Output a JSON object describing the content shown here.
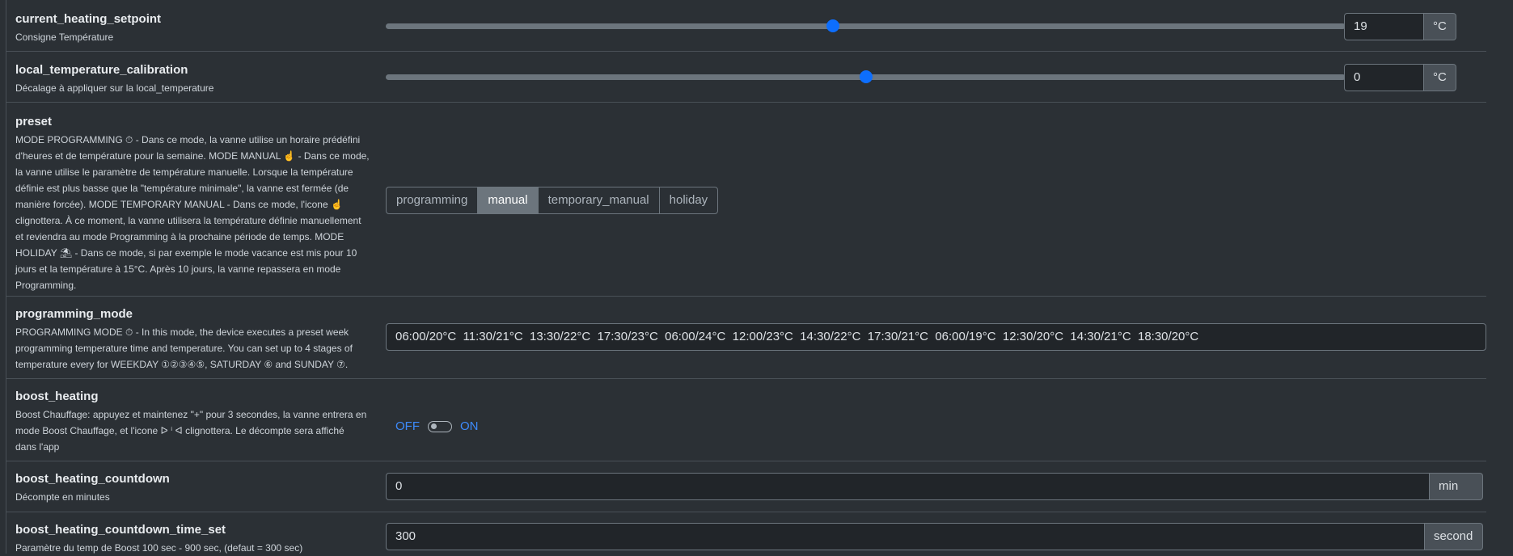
{
  "rows": {
    "heating_setpoint": {
      "name": "current_heating_setpoint",
      "desc": "Consigne Température",
      "value": "19",
      "unit": "°C",
      "slider_fraction": 0.466
    },
    "temp_calibration": {
      "name": "local_temperature_calibration",
      "desc": "Décalage à appliquer sur la local_temperature",
      "value": "0",
      "unit": "°C",
      "slider_fraction": 0.5
    },
    "preset": {
      "name": "preset",
      "desc_lines": [
        "MODE PROGRAMMING ⏱ - Dans ce mode, la vanne utilise un horaire prédéfini",
        "d'heures et de température pour la semaine. MODE MANUAL ☝ - Dans ce mode,",
        "la vanne utilise le paramètre de température manuelle. Lorsque la température",
        "définie est plus basse que la \"température minimale\", la vanne est fermée (de",
        "manière forcée). MODE TEMPORARY MANUAL - Dans ce mode, l'icone ☝",
        "clignottera. À ce moment, la vanne utilisera la température définie manuellement",
        "et reviendra au mode Programming à la prochaine période de temps. MODE",
        "HOLIDAY ⛱ - Dans ce mode, si par exemple le mode vacance est mis pour 10",
        "jours et la température à 15°C. Après 10 jours, la vanne repassera en mode",
        "Programming."
      ],
      "options": [
        "programming",
        "manual",
        "temporary_manual",
        "holiday"
      ],
      "selected": "manual"
    },
    "programming_mode": {
      "name": "programming_mode",
      "desc_lines": [
        "PROGRAMMING MODE ⏱ - In this mode, the device executes a preset week",
        "programming temperature time and temperature. You can set up to 4 stages of",
        "temperature every for WEEKDAY ①②③④⑤, SATURDAY ⑥ and SUNDAY ⑦."
      ],
      "value": "06:00/20°C  11:30/21°C  13:30/22°C  17:30/23°C  06:00/24°C  12:00/23°C  14:30/22°C  17:30/21°C  06:00/19°C  12:30/20°C  14:30/21°C  18:30/20°C"
    },
    "boost_heating": {
      "name": "boost_heating",
      "desc_lines": [
        "Boost Chauffage: appuyez et maintenez \"+\" pour 3 secondes, la vanne entrera en",
        "mode Boost Chauffage, et l'icone ᐅ ⁱ ᐊ clignottera. Le décompte sera affiché",
        "dans l'app"
      ],
      "off_label": "OFF",
      "on_label": "ON",
      "state": "OFF"
    },
    "boost_countdown": {
      "name": "boost_heating_countdown",
      "desc": "Décompte en minutes",
      "value": "0",
      "unit": "min"
    },
    "boost_time_set": {
      "name": "boost_heating_countdown_time_set",
      "desc": "Paramètre du temp de Boost 100 sec - 900 sec, (defaut = 300 sec)",
      "value": "300",
      "unit": "second"
    }
  },
  "colors": {
    "background": "#2b3035",
    "accent": "#0d6efd",
    "active_button": "#6c757d"
  }
}
